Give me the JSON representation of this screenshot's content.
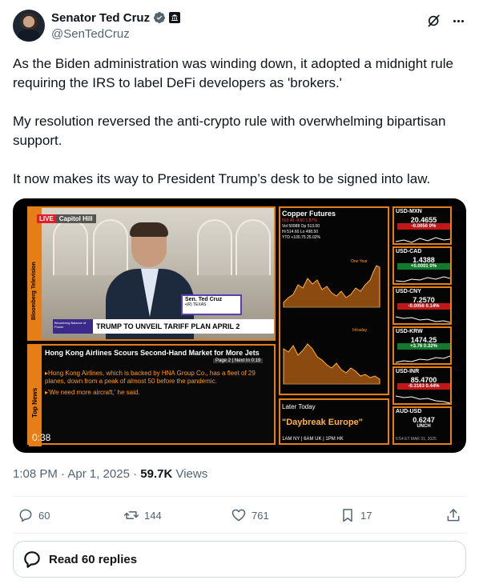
{
  "author": {
    "name": "Senator Ted Cruz",
    "handle": "@SenTedCruz"
  },
  "tweet": {
    "paragraphs": [
      "As the Biden administration was winding down, it adopted a midnight rule requiring the IRS to label DeFi developers as 'brokers.'",
      "My resolution reversed the anti-crypto rule with overwhelming bipartisan support.",
      "It now makes its way to President Trump’s desk to be signed into law."
    ]
  },
  "video": {
    "duration": "0:38",
    "live_label": "LIVE",
    "location": "Capitol Hill",
    "side_brand": "Bloomberg Television",
    "name_chyron": {
      "name": "Sen. Ted Cruz",
      "title": "•(R) TEXAS"
    },
    "headline": "TRUMP TO UNVEIL TARIFF PLAN APRIL 2",
    "headline_logo": "Bloomberg Balance of Power",
    "news_side": "Top News",
    "news_title": "Hong Kong Airlines Scours Second-Hand Market for More Jets",
    "news_page": "Page 2 | Next In 0:19",
    "news_bullets": [
      "▸Hong Kong Airlines, which is backed by HNA Group Co., has a fleet of 29 planes, down from a peak of almost 50 before the pandemic.",
      "▸'We need more aircraft,' he said."
    ],
    "chart": {
      "title": "Copper Futures",
      "stats_line1": "503.40 -9.60 1.87%",
      "stats_line2": "Vol 50988 Op 513.00",
      "stats_line3": "Hi 514.60 Lo 498.50",
      "stats_line4": "YTD +100.75 25.02%",
      "one_year_label": "One Year",
      "intraday_label": "Intraday"
    },
    "later": {
      "title": "Later Today",
      "show": "\"Daybreak Europe\"",
      "times": "1AM NY | 6AM UK | 1PM HK"
    },
    "fx": [
      {
        "pair": "USD-MXN",
        "price": "20.4655",
        "change": "-0.0056 0%",
        "dir": "neg"
      },
      {
        "pair": "USD-CAD",
        "price": "1.4388",
        "change": "+0.0001 0%",
        "dir": "pos"
      },
      {
        "pair": "USD-CNY",
        "price": "7.2570",
        "change": "-0.0056 0.14%",
        "dir": "neg"
      },
      {
        "pair": "USD-KRW",
        "price": "1474.25",
        "change": "+3.76 0.32%",
        "dir": "pos"
      },
      {
        "pair": "USD-INR",
        "price": "85.4700",
        "change": "-0.3163 0.44%",
        "dir": "neg"
      },
      {
        "pair": "AUD-USD",
        "price": "0.6247",
        "change": "UNCH",
        "dir": "flat"
      }
    ],
    "footer_time": "6:54 ET    MAR 31, 2025"
  },
  "meta": {
    "time": "1:08 PM · Apr 1, 2025 · ",
    "views_count": "59.7K",
    "views_label": " Views"
  },
  "actions": {
    "replies": "60",
    "reposts": "144",
    "likes": "761",
    "bookmarks": "17"
  },
  "read_replies": "Read 60 replies",
  "colors": {
    "brand_orange": "#e57e16",
    "text_primary": "#0f1419",
    "text_secondary": "#536471",
    "verified_blue": "#1d9bf0"
  }
}
